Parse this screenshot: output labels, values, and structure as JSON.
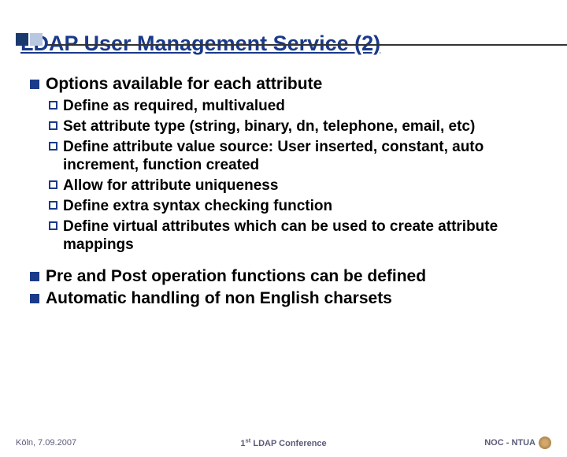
{
  "title": "LDAP  User Management Service (2)",
  "main": {
    "items": [
      {
        "label": "Options available for each attribute",
        "sub": [
          "Define as required, multivalued",
          "Set attribute type (string, binary, dn, telephone, email, etc)",
          "Define attribute value source: User inserted, constant, auto increment, function created",
          "Allow for attribute uniqueness",
          "Define extra syntax checking function",
          "Define virtual attributes which can be used to create attribute mappings"
        ]
      },
      {
        "label": "Pre and Post operation functions can be defined",
        "sub": []
      },
      {
        "label": "Automatic handling of non English charsets",
        "sub": []
      }
    ]
  },
  "footer": {
    "left": "Köln, 7.09.2007",
    "center_prefix": "1",
    "center_sup": "st",
    "center_suffix": " LDAP Conference",
    "right": "NOC - NTUA"
  }
}
